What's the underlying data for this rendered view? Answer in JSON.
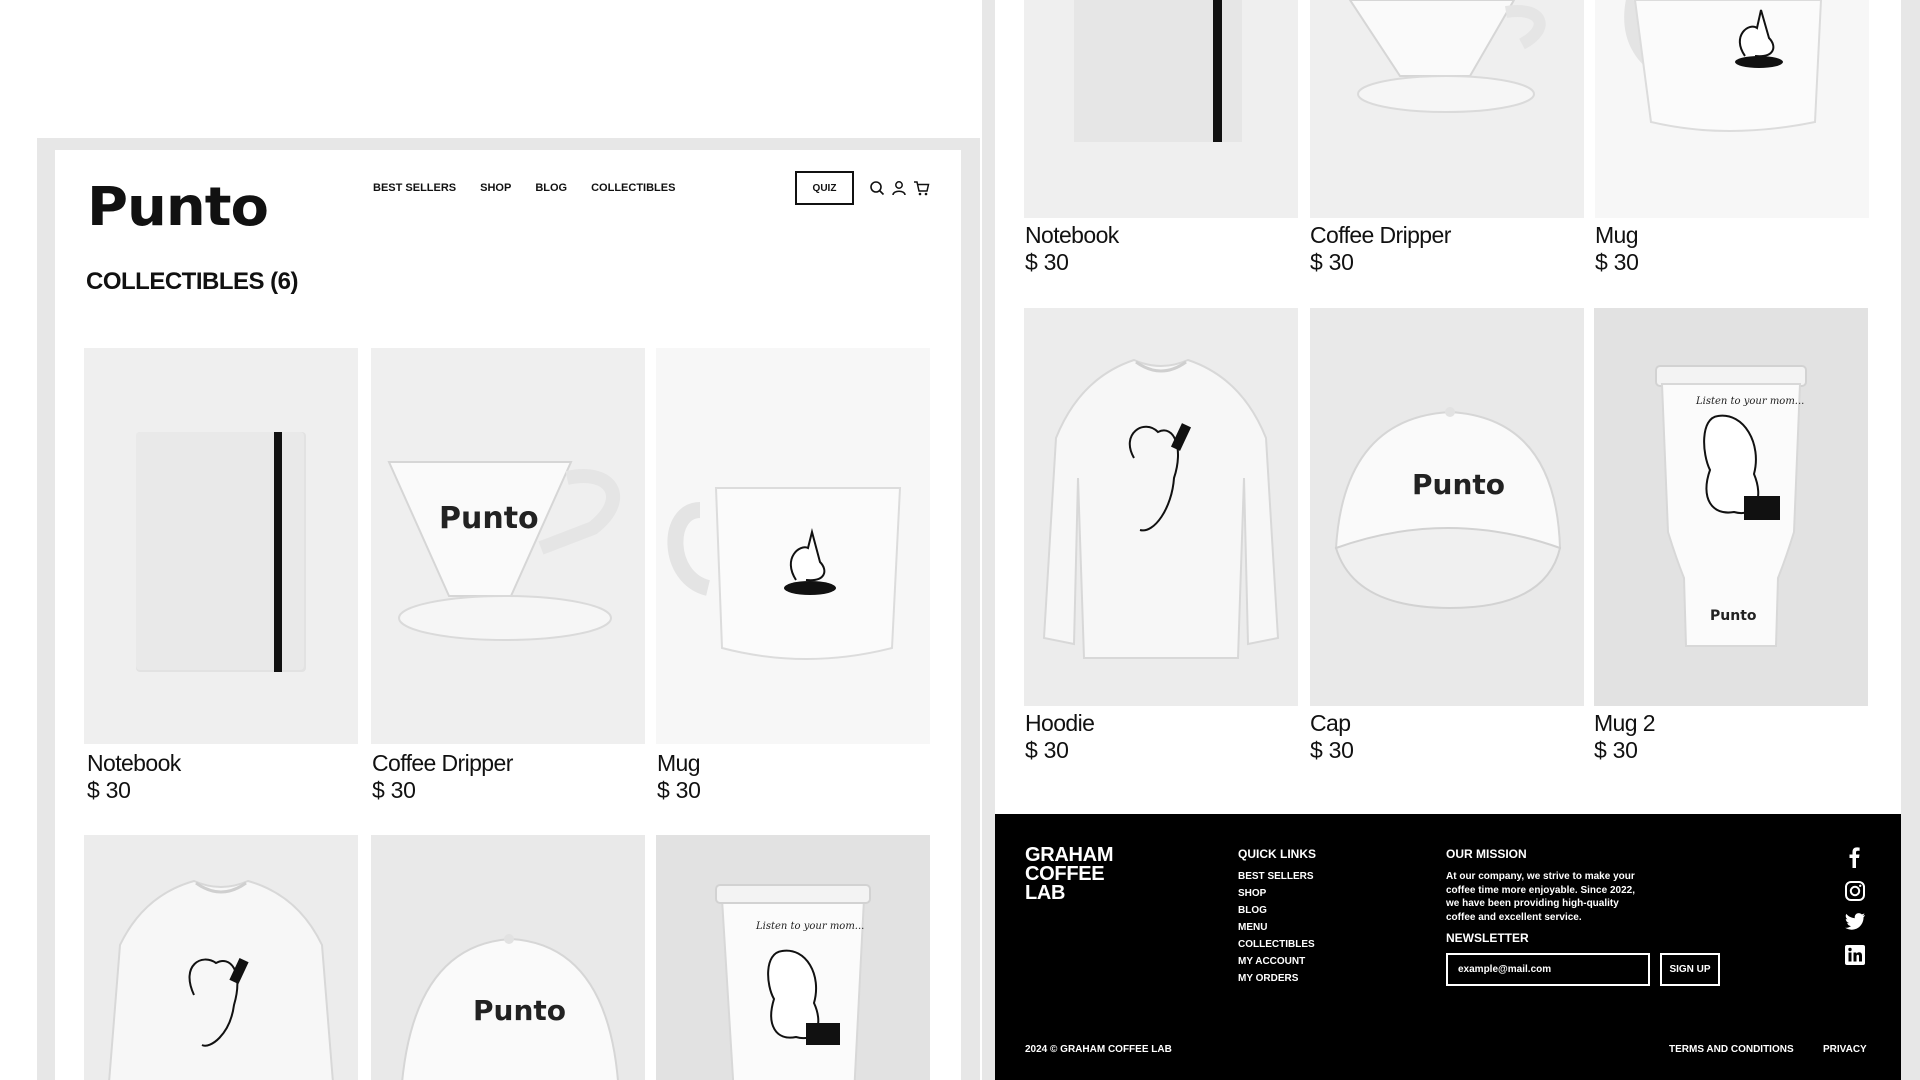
{
  "left": {
    "logo": "Punto",
    "nav": [
      "BEST SELLERS",
      "SHOP",
      "BLOG",
      "COLLECTIBLES"
    ],
    "quiz_label": "QUIZ",
    "page_title": "COLLECTIBLES (6)",
    "products": [
      {
        "name": "Notebook",
        "price": "$ 30"
      },
      {
        "name": "Coffee Dripper",
        "price": "$ 30"
      },
      {
        "name": "Mug",
        "price": "$ 30"
      }
    ]
  },
  "right": {
    "products": [
      {
        "name": "Notebook",
        "price": "$ 30"
      },
      {
        "name": "Coffee Dripper",
        "price": "$ 30"
      },
      {
        "name": "Mug",
        "price": "$ 30"
      },
      {
        "name": "Hoodie",
        "price": "$ 30"
      },
      {
        "name": "Cap",
        "price": "$ 30"
      },
      {
        "name": "Mug 2",
        "price": "$ 30"
      }
    ],
    "product_print_text": "Punto",
    "tumbler_script": "Listen to your mom...",
    "footer": {
      "brand_lines": [
        "GRAHAM",
        "COFFEE",
        "LAB"
      ],
      "quick_links_heading": "QUICK LINKS",
      "quick_links": [
        "BEST SELLERS",
        "SHOP",
        "BLOG",
        "MENU",
        "COLLECTIBLES",
        "MY ACCOUNT",
        "MY ORDERS"
      ],
      "mission_heading": "OUR MISSION",
      "mission_text": "At our company, we strive to make your coffee time more enjoyable. Since 2022, we have been providing high-quality coffee and excellent service.",
      "newsletter_heading": "NEWSLETTER",
      "email_placeholder": "example@mail.com",
      "signup_label": "SIGN UP",
      "copyright": "2024 © GRAHAM COFFEE LAB",
      "terms": "TERMS AND CONDITIONS",
      "privacy": "PRIVACY",
      "social_icons": [
        "facebook-icon",
        "instagram-icon",
        "twitter-icon",
        "linkedin-icon"
      ]
    }
  },
  "colors": {
    "background": "#ffffff",
    "frame": "#e7e7e7",
    "text": "#111111",
    "footer_bg": "#000000",
    "product_bg": "#f2f2f2"
  }
}
